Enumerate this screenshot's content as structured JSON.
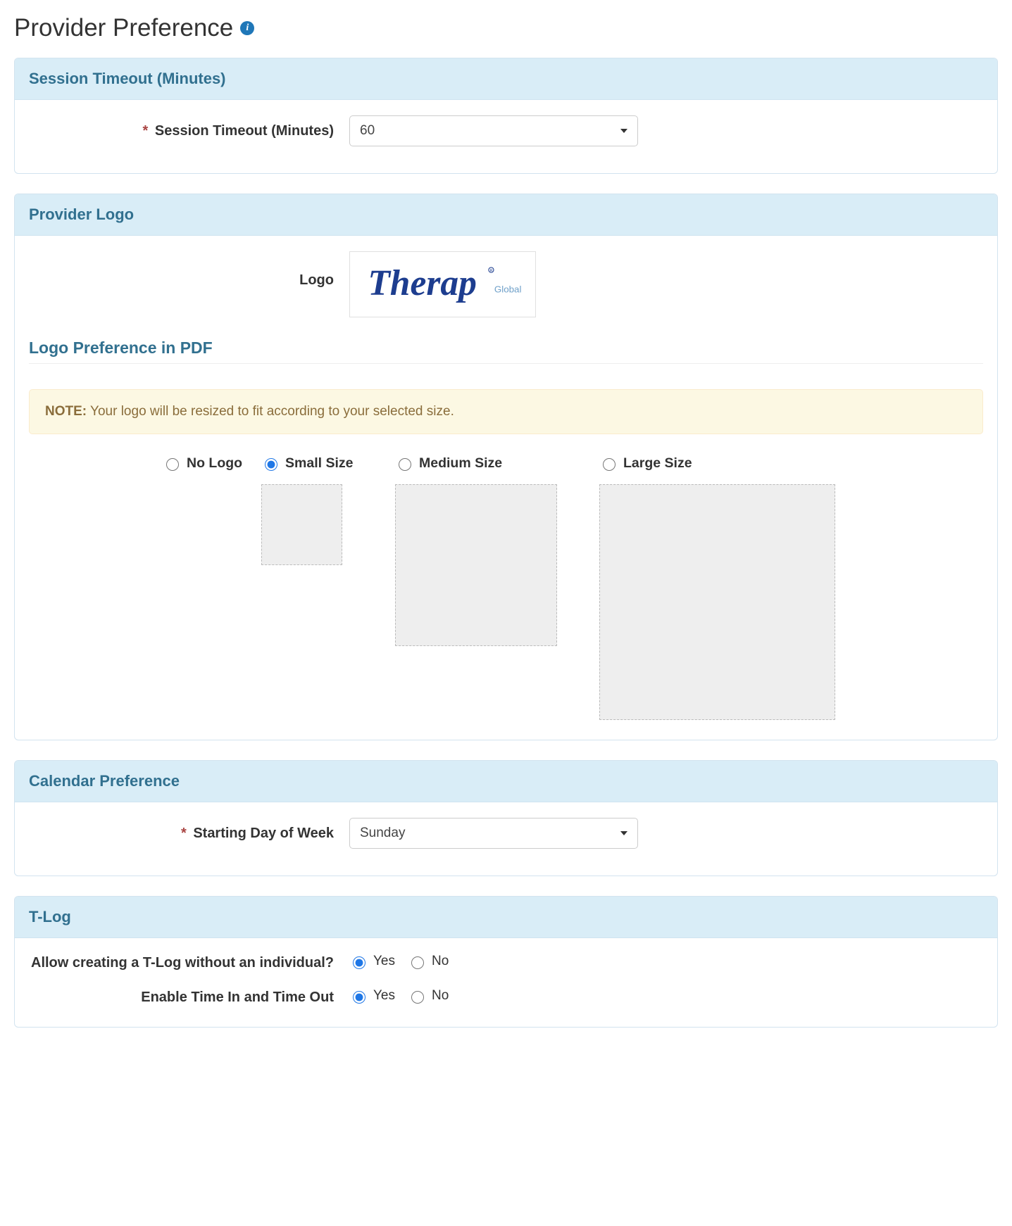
{
  "page": {
    "title": "Provider Preference"
  },
  "sessionTimeout": {
    "panelTitle": "Session Timeout (Minutes)",
    "label": "Session Timeout (Minutes)",
    "value": "60"
  },
  "providerLogo": {
    "panelTitle": "Provider Logo",
    "logoLabel": "Logo",
    "logoBrand": "Therap",
    "logoSub": "Global",
    "subheading": "Logo Preference in PDF",
    "noteLabel": "NOTE:",
    "noteText": "Your logo will be resized to fit according to your selected size.",
    "options": {
      "noLogo": "No Logo",
      "small": "Small Size",
      "medium": "Medium Size",
      "large": "Large Size"
    },
    "selected": "small"
  },
  "calendar": {
    "panelTitle": "Calendar Preference",
    "label": "Starting Day of Week",
    "value": "Sunday"
  },
  "tlog": {
    "panelTitle": "T-Log",
    "q1": "Allow creating a T-Log without an individual?",
    "q2": "Enable Time In and Time Out",
    "yes": "Yes",
    "no": "No",
    "q1_selected": "yes",
    "q2_selected": "yes"
  }
}
